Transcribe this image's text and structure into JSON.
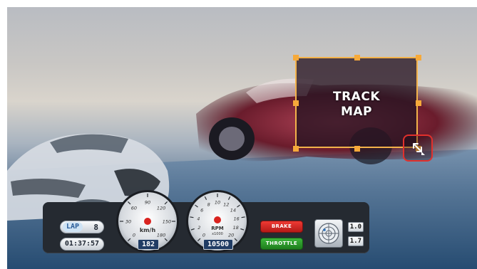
{
  "overlay": {
    "track_map_label": "TRACK\nMAP"
  },
  "hud": {
    "lap": {
      "label": "LAP",
      "value": "8",
      "time": "01:37:57"
    },
    "speedometer": {
      "unit": "km/h",
      "value": "182",
      "ticks": [
        "0",
        "30",
        "60",
        "90",
        "120",
        "150",
        "180"
      ]
    },
    "tachometer": {
      "unit": "RPM",
      "multiplier": "x1000",
      "value": "10500",
      "ticks": [
        "0",
        "2",
        "4",
        "6",
        "8",
        "10",
        "12",
        "14",
        "16",
        "18",
        "20"
      ]
    },
    "brake_label": "BRAKE",
    "throttle_label": "THROTTLE",
    "readout_top": "1.0",
    "readout_bottom": "1.7"
  },
  "colors": {
    "accent": "#f6a93a",
    "brake": "#d9231f",
    "throttle": "#2d9d2a",
    "resize_border": "#e1302c"
  },
  "icons": [
    "resize-diagonal-icon",
    "radar-icon"
  ]
}
